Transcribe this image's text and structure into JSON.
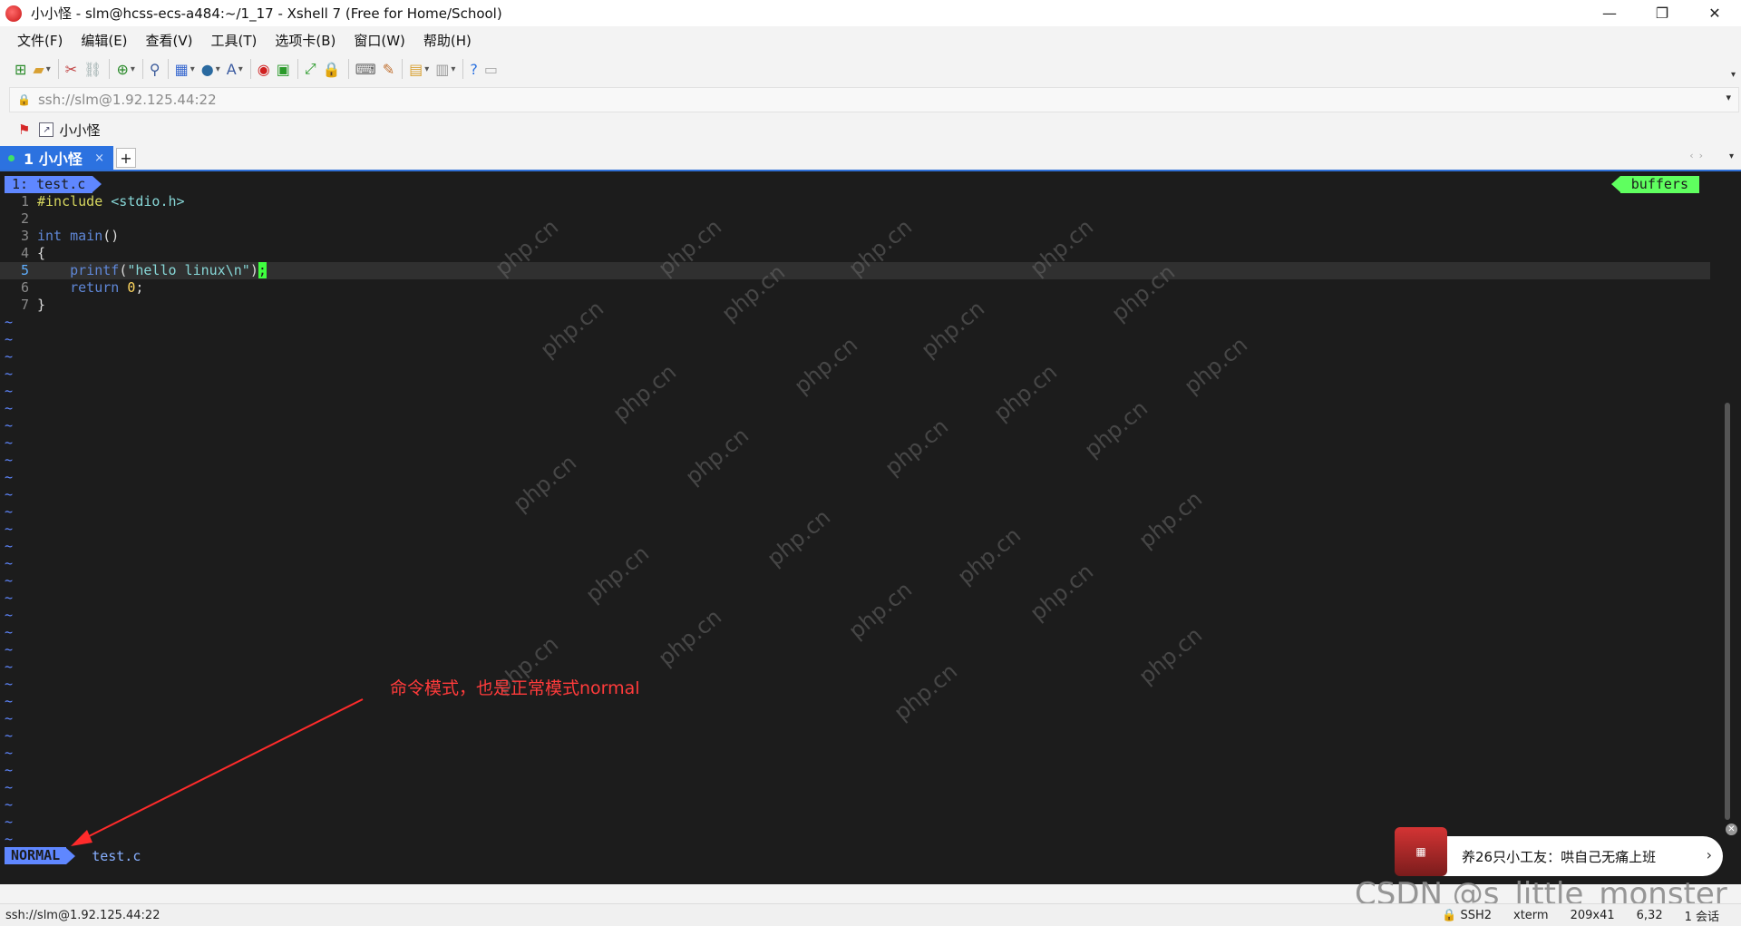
{
  "window": {
    "title": "小小怪 - slm@hcss-ecs-a484:~/1_17 - Xshell 7 (Free for Home/School)"
  },
  "menu": {
    "items": [
      "文件(F)",
      "编辑(E)",
      "查看(V)",
      "工具(T)",
      "选项卡(B)",
      "窗口(W)",
      "帮助(H)"
    ]
  },
  "address": {
    "value": "ssh://slm@1.92.125.44:22"
  },
  "links": {
    "label": "小小怪"
  },
  "tab": {
    "label": "1 小小怪",
    "close": "×",
    "add": "+"
  },
  "vim": {
    "buffer_tab": "1: test.c",
    "buffers_label": "buffers",
    "lines": [
      {
        "n": "1"
      },
      {
        "n": "2"
      },
      {
        "n": "3"
      },
      {
        "n": "4"
      },
      {
        "n": "5"
      },
      {
        "n": "6"
      },
      {
        "n": "7"
      }
    ],
    "code": {
      "l1_directive": "#include",
      "l1_header": "<stdio.h>",
      "l3_type": "int",
      "l3_name": "main",
      "l3_parens": "()",
      "l4": "{",
      "l5_func": "printf",
      "l5_open": "(",
      "l5_str": "\"hello linux\\n\"",
      "l5_close": ")",
      "l5_cursor": ";",
      "l6_kw": "return",
      "l6_num": "0",
      "l6_semi": ";",
      "l7": "}"
    },
    "tilde": "~",
    "mode": "NORMAL",
    "file": "test.c"
  },
  "annotation": "命令模式，也是正常模式normal",
  "watermark_text": "php.cn",
  "promo": {
    "text": "养26只小工友：哄自己无痛上班",
    "chevron": "›"
  },
  "csdn": "CSDN @s_little_monster",
  "status": {
    "left": "ssh://slm@1.92.125.44:22",
    "protocol": "SSH2",
    "term": "xterm",
    "size": "209x41",
    "pos": "6,32",
    "sessions": "1 会话"
  },
  "colors": {
    "accent": "#2c72e0",
    "vim_blue": "#5f87ff",
    "vim_green": "#5fff5f",
    "annotation": "#ff3b3b"
  }
}
